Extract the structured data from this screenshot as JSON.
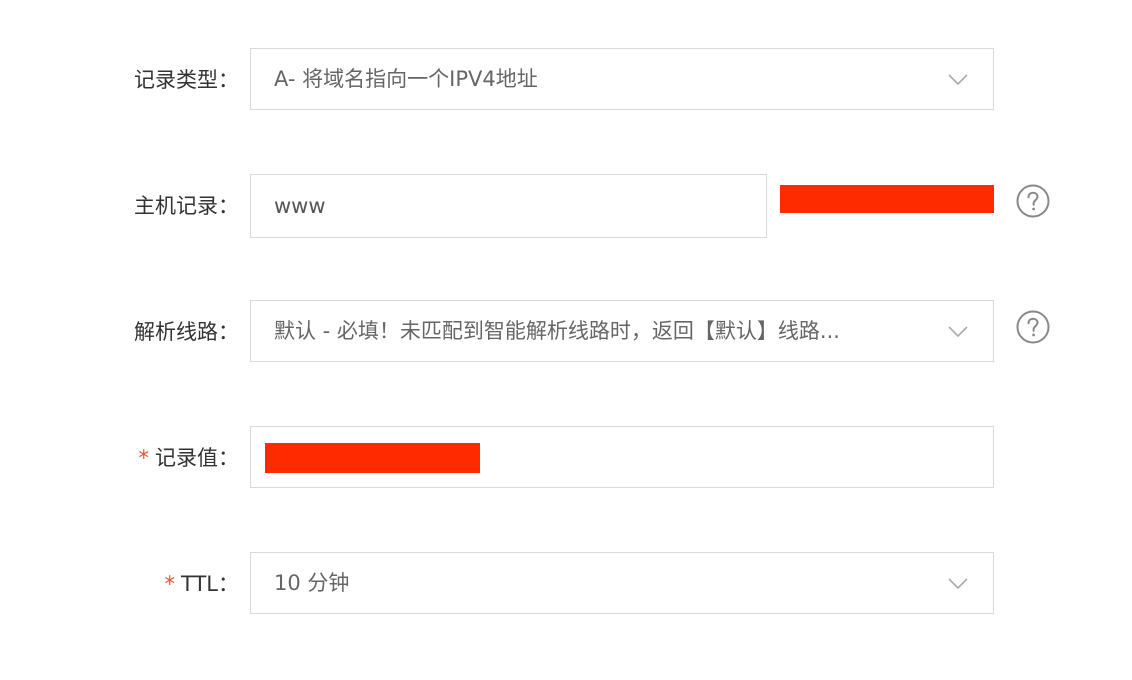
{
  "form": {
    "record_type": {
      "label": "记录类型：",
      "value": "A- 将域名指向一个IPV4地址"
    },
    "host_record": {
      "label": "主机记录：",
      "value": "www"
    },
    "resolution_line": {
      "label": "解析线路：",
      "value": "默认 - 必填！未匹配到智能解析线路时，返回【默认】线路..."
    },
    "record_value": {
      "required_mark": "*",
      "label": "记录值："
    },
    "ttl": {
      "required_mark": "*",
      "label": "TTL：",
      "value": "10 分钟"
    }
  },
  "colors": {
    "required": "#e8502f",
    "redaction": "#ff2a00",
    "border": "#d9d9d9"
  },
  "icons": [
    "chevron-down-icon",
    "help-circle-icon"
  ]
}
